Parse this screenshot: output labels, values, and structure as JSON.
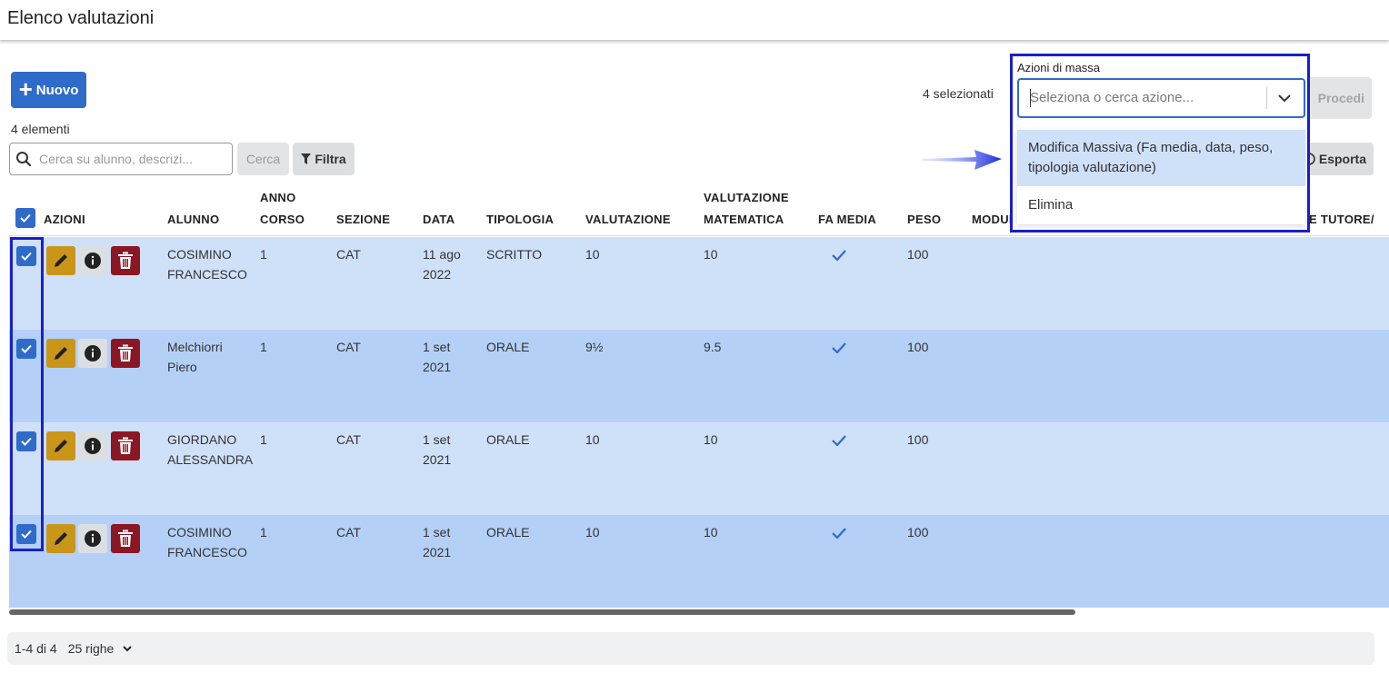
{
  "header": {
    "title": "Elenco valutazioni"
  },
  "toolbar": {
    "new_label": "Nuovo",
    "count_label": "4 elementi",
    "search_placeholder": "Cerca su alunno, descrizi...",
    "search_value": "",
    "cerca_label": "Cerca",
    "filtra_label": "Filtra",
    "selected_label": "4 selezionati",
    "procedi_label": "Procedi",
    "esporta_label": "Esporta"
  },
  "mass_actions": {
    "label": "Azioni di massa",
    "placeholder": "Seleziona o cerca azione...",
    "options": [
      {
        "label": "Modifica Massiva (Fa media, data, peso, tipologia valutazione)"
      },
      {
        "label": "Elimina"
      }
    ]
  },
  "table": {
    "columns": {
      "azioni": "AZIONI",
      "alunno": "ALUNNO",
      "anno_corso": "ANNO CORSO",
      "sezione": "SEZIONE",
      "data": "DATA",
      "tipologia": "TIPOLOGIA",
      "valutazione": "VALUTAZIONE",
      "valutazione_matematica": "VALUTAZIONE MATEMATICA",
      "fa_media": "FA MEDIA",
      "peso": "PESO",
      "modulo": "MODUL",
      "tutore": "E TUTORE/"
    },
    "rows": [
      {
        "alunno": "COSIMINO FRANCESCO",
        "anno": "1",
        "sezione": "CAT",
        "data": "11 ago 2022",
        "tipologia": "SCRITTO",
        "valutazione": "10",
        "matematica": "10",
        "peso": "100"
      },
      {
        "alunno": "Melchiorri Piero",
        "anno": "1",
        "sezione": "CAT",
        "data": "1 set 2021",
        "tipologia": "ORALE",
        "valutazione": "9½",
        "matematica": "9.5",
        "peso": "100"
      },
      {
        "alunno": "GIORDANO ALESSANDRA",
        "anno": "1",
        "sezione": "CAT",
        "data": "1 set 2021",
        "tipologia": "ORALE",
        "valutazione": "10",
        "matematica": "10",
        "peso": "100"
      },
      {
        "alunno": "COSIMINO FRANCESCO",
        "anno": "1",
        "sezione": "CAT",
        "data": "1 set 2021",
        "tipologia": "ORALE",
        "valutazione": "10",
        "matematica": "10",
        "peso": "100"
      }
    ]
  },
  "pager": {
    "range": "1-4 di 4",
    "rows_per_page": "25 righe"
  },
  "colors": {
    "primary": "#2f6bc9",
    "edit": "#c9961a",
    "delete": "#8c1724",
    "row_light": "#cfe0f9",
    "row_dark": "#b4d0f7",
    "highlight": "#1820c8"
  }
}
